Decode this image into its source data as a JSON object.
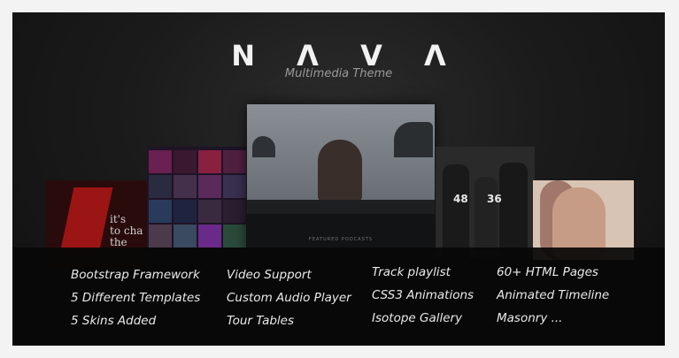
{
  "brand": {
    "logo": "N Λ V Λ",
    "tagline": "Multimedia Theme"
  },
  "previews": {
    "left_text": "it's\nto cha\nthe",
    "center_footer": "FEATURED PODCASTS",
    "band_numbers": [
      "48",
      "36"
    ]
  },
  "features": {
    "col1": [
      "Bootstrap Framework",
      "5 Different Templates",
      "5 Skins Added"
    ],
    "col2": [
      "Video Support",
      "Custom Audio Player",
      "Tour Tables"
    ],
    "col3": [
      "Track playlist",
      "CSS3 Animations",
      "Isotope Gallery"
    ],
    "col4": [
      "60+ HTML Pages",
      "Animated Timeline",
      "Masonry ..."
    ]
  }
}
